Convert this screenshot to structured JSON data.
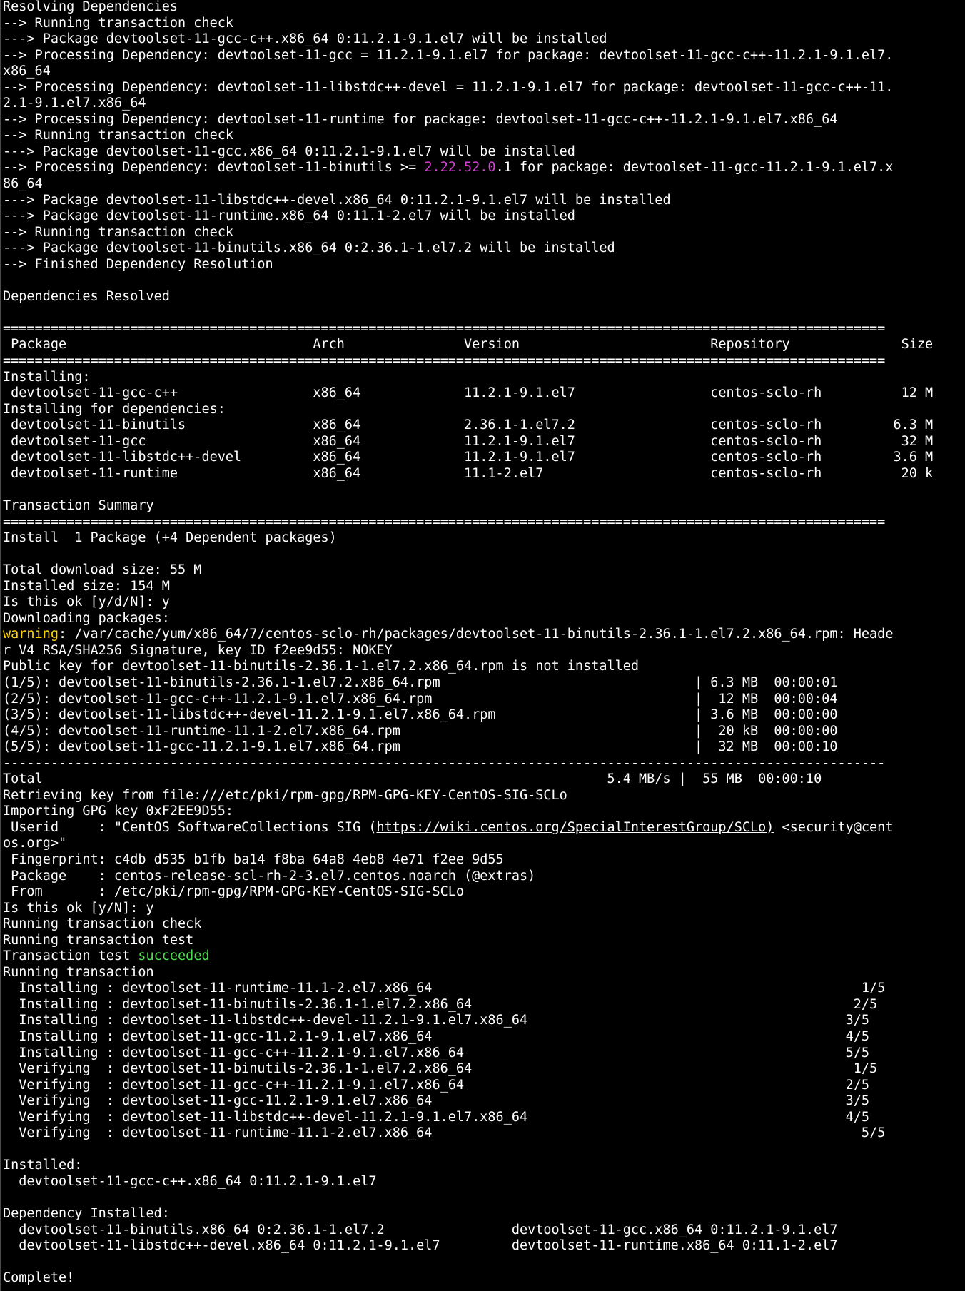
{
  "colors": {
    "background": "#000000",
    "foreground": "#ffffff",
    "warning": "#ffd700",
    "version_highlight": "#d43fd4",
    "success": "#4fdc4f"
  },
  "lines": [
    {
      "name": "log-line",
      "segments": [
        {
          "text": "Resolving Dependencies"
        }
      ]
    },
    {
      "name": "log-line",
      "segments": [
        {
          "text": "--> Running transaction check"
        }
      ]
    },
    {
      "name": "log-line",
      "segments": [
        {
          "text": "---> Package devtoolset-11-gcc-c++.x86_64 0:11.2.1-9.1.el7 will be installed"
        }
      ]
    },
    {
      "name": "log-line",
      "segments": [
        {
          "text": "--> Processing Dependency: devtoolset-11-gcc = 11.2.1-9.1.el7 for package: devtoolset-11-gcc-c++-11.2.1-9.1.el7."
        }
      ]
    },
    {
      "name": "log-line",
      "segments": [
        {
          "text": "x86_64"
        }
      ]
    },
    {
      "name": "log-line",
      "segments": [
        {
          "text": "--> Processing Dependency: devtoolset-11-libstdc++-devel = 11.2.1-9.1.el7 for package: devtoolset-11-gcc-c++-11."
        }
      ]
    },
    {
      "name": "log-line",
      "segments": [
        {
          "text": "2.1-9.1.el7.x86_64"
        }
      ]
    },
    {
      "name": "log-line",
      "segments": [
        {
          "text": "--> Processing Dependency: devtoolset-11-runtime for package: devtoolset-11-gcc-c++-11.2.1-9.1.el7.x86_64"
        }
      ]
    },
    {
      "name": "log-line",
      "segments": [
        {
          "text": "--> Running transaction check"
        }
      ]
    },
    {
      "name": "log-line",
      "segments": [
        {
          "text": "---> Package devtoolset-11-gcc.x86_64 0:11.2.1-9.1.el7 will be installed"
        }
      ]
    },
    {
      "name": "log-line",
      "segments": [
        {
          "text": "--> Processing Dependency: devtoolset-11-binutils >= "
        },
        {
          "text": "2.22.52.0",
          "class": "seg-magenta"
        },
        {
          "text": ".1 for package: devtoolset-11-gcc-11.2.1-9.1.el7.x"
        }
      ]
    },
    {
      "name": "log-line",
      "segments": [
        {
          "text": "86_64"
        }
      ]
    },
    {
      "name": "log-line",
      "segments": [
        {
          "text": "---> Package devtoolset-11-libstdc++-devel.x86_64 0:11.2.1-9.1.el7 will be installed"
        }
      ]
    },
    {
      "name": "log-line",
      "segments": [
        {
          "text": "---> Package devtoolset-11-runtime.x86_64 0:11.1-2.el7 will be installed"
        }
      ]
    },
    {
      "name": "log-line",
      "segments": [
        {
          "text": "--> Running transaction check"
        }
      ]
    },
    {
      "name": "log-line",
      "segments": [
        {
          "text": "---> Package devtoolset-11-binutils.x86_64 0:2.36.1-1.el7.2 will be installed"
        }
      ]
    },
    {
      "name": "log-line",
      "segments": [
        {
          "text": "--> Finished Dependency Resolution"
        }
      ]
    },
    {
      "name": "blank-line",
      "segments": [
        {
          "text": ""
        }
      ]
    },
    {
      "name": "section-heading",
      "segments": [
        {
          "text": "Dependencies Resolved"
        }
      ]
    },
    {
      "name": "blank-line",
      "segments": [
        {
          "text": ""
        }
      ]
    },
    {
      "name": "separator-line",
      "segments": [
        {
          "text": "==============================================================================================================="
        }
      ]
    },
    {
      "name": "table-header",
      "segments": [
        {
          "text": " Package                               Arch               Version                        Repository              Size"
        }
      ]
    },
    {
      "name": "separator-line",
      "segments": [
        {
          "text": "==============================================================================================================="
        }
      ]
    },
    {
      "name": "table-group-heading",
      "segments": [
        {
          "text": "Installing:"
        }
      ]
    },
    {
      "name": "table-row",
      "segments": [
        {
          "text": " devtoolset-11-gcc-c++                 x86_64             11.2.1-9.1.el7                 centos-sclo-rh          12 M"
        }
      ]
    },
    {
      "name": "table-group-heading",
      "segments": [
        {
          "text": "Installing for dependencies:"
        }
      ]
    },
    {
      "name": "table-row",
      "segments": [
        {
          "text": " devtoolset-11-binutils                x86_64             2.36.1-1.el7.2                 centos-sclo-rh         6.3 M"
        }
      ]
    },
    {
      "name": "table-row",
      "segments": [
        {
          "text": " devtoolset-11-gcc                     x86_64             11.2.1-9.1.el7                 centos-sclo-rh          32 M"
        }
      ]
    },
    {
      "name": "table-row",
      "segments": [
        {
          "text": " devtoolset-11-libstdc++-devel         x86_64             11.2.1-9.1.el7                 centos-sclo-rh         3.6 M"
        }
      ]
    },
    {
      "name": "table-row",
      "segments": [
        {
          "text": " devtoolset-11-runtime                 x86_64             11.1-2.el7                     centos-sclo-rh          20 k"
        }
      ]
    },
    {
      "name": "blank-line",
      "segments": [
        {
          "text": ""
        }
      ]
    },
    {
      "name": "section-heading",
      "segments": [
        {
          "text": "Transaction Summary"
        }
      ]
    },
    {
      "name": "separator-line",
      "segments": [
        {
          "text": "==============================================================================================================="
        }
      ]
    },
    {
      "name": "log-line",
      "segments": [
        {
          "text": "Install  1 Package (+4 Dependent packages)"
        }
      ]
    },
    {
      "name": "blank-line",
      "segments": [
        {
          "text": ""
        }
      ]
    },
    {
      "name": "log-line",
      "segments": [
        {
          "text": "Total download size: 55 M"
        }
      ]
    },
    {
      "name": "log-line",
      "segments": [
        {
          "text": "Installed size: 154 M"
        }
      ]
    },
    {
      "name": "prompt-line",
      "segments": [
        {
          "text": "Is this ok [y/d/N]: y"
        }
      ]
    },
    {
      "name": "log-line",
      "segments": [
        {
          "text": "Downloading packages:"
        }
      ]
    },
    {
      "name": "warning-line",
      "segments": [
        {
          "text": "warning",
          "class": "seg-yellow"
        },
        {
          "text": ": /var/cache/yum/x86_64/7/centos-sclo-rh/packages/devtoolset-11-binutils-2.36.1-1.el7.2.x86_64.rpm: Heade"
        }
      ]
    },
    {
      "name": "warning-line",
      "segments": [
        {
          "text": "r V4 RSA/SHA256 Signature, key ID f2ee9d55: NOKEY"
        }
      ]
    },
    {
      "name": "log-line",
      "segments": [
        {
          "text": "Public key for devtoolset-11-binutils-2.36.1-1.el7.2.x86_64.rpm is not installed"
        }
      ]
    },
    {
      "name": "download-line",
      "segments": [
        {
          "text": "(1/5): devtoolset-11-binutils-2.36.1-1.el7.2.x86_64.rpm                                | 6.3 MB  00:00:01"
        }
      ]
    },
    {
      "name": "download-line",
      "segments": [
        {
          "text": "(2/5): devtoolset-11-gcc-c++-11.2.1-9.1.el7.x86_64.rpm                                 |  12 MB  00:00:04"
        }
      ]
    },
    {
      "name": "download-line",
      "segments": [
        {
          "text": "(3/5): devtoolset-11-libstdc++-devel-11.2.1-9.1.el7.x86_64.rpm                         | 3.6 MB  00:00:00"
        }
      ]
    },
    {
      "name": "download-line",
      "segments": [
        {
          "text": "(4/5): devtoolset-11-runtime-11.1-2.el7.x86_64.rpm                                     |  20 kB  00:00:00"
        }
      ]
    },
    {
      "name": "download-line",
      "segments": [
        {
          "text": "(5/5): devtoolset-11-gcc-11.2.1-9.1.el7.x86_64.rpm                                     |  32 MB  00:00:10"
        }
      ]
    },
    {
      "name": "separator-line",
      "segments": [
        {
          "text": "---------------------------------------------------------------------------------------------------------------"
        }
      ]
    },
    {
      "name": "download-total-line",
      "segments": [
        {
          "text": "Total                                                                       5.4 MB/s |  55 MB  00:00:10"
        }
      ]
    },
    {
      "name": "log-line",
      "segments": [
        {
          "text": "Retrieving key from file:///etc/pki/rpm-gpg/RPM-GPG-KEY-CentOS-SIG-SCLo"
        }
      ]
    },
    {
      "name": "log-line",
      "segments": [
        {
          "text": "Importing GPG key 0xF2EE9D55:"
        }
      ]
    },
    {
      "name": "gpg-userid-line",
      "segments": [
        {
          "text": " Userid     : \"CentOS SoftwareCollections SIG ("
        },
        {
          "text": "https://wiki.centos.org/SpecialInterestGroup/SCLo)",
          "class": "seg-link"
        },
        {
          "text": " <security@cent"
        }
      ]
    },
    {
      "name": "gpg-userid-line",
      "segments": [
        {
          "text": "os.org>\""
        }
      ]
    },
    {
      "name": "gpg-line",
      "segments": [
        {
          "text": " Fingerprint: c4db d535 b1fb ba14 f8ba 64a8 4eb8 4e71 f2ee 9d55"
        }
      ]
    },
    {
      "name": "gpg-line",
      "segments": [
        {
          "text": " Package    : centos-release-scl-rh-2-3.el7.centos.noarch (@extras)"
        }
      ]
    },
    {
      "name": "gpg-line",
      "segments": [
        {
          "text": " From       : /etc/pki/rpm-gpg/RPM-GPG-KEY-CentOS-SIG-SCLo"
        }
      ]
    },
    {
      "name": "prompt-line",
      "segments": [
        {
          "text": "Is this ok [y/N]: y"
        }
      ]
    },
    {
      "name": "log-line",
      "segments": [
        {
          "text": "Running transaction check"
        }
      ]
    },
    {
      "name": "log-line",
      "segments": [
        {
          "text": "Running transaction test"
        }
      ]
    },
    {
      "name": "log-line",
      "segments": [
        {
          "text": "Transaction test "
        },
        {
          "text": "succeeded",
          "class": "seg-green"
        }
      ]
    },
    {
      "name": "log-line",
      "segments": [
        {
          "text": "Running transaction"
        }
      ]
    },
    {
      "name": "progress-line",
      "segments": [
        {
          "text": "  Installing : devtoolset-11-runtime-11.1-2.el7.x86_64                                                      1/5"
        }
      ]
    },
    {
      "name": "progress-line",
      "segments": [
        {
          "text": "  Installing : devtoolset-11-binutils-2.36.1-1.el7.2.x86_64                                                2/5"
        }
      ]
    },
    {
      "name": "progress-line",
      "segments": [
        {
          "text": "  Installing : devtoolset-11-libstdc++-devel-11.2.1-9.1.el7.x86_64                                        3/5"
        }
      ]
    },
    {
      "name": "progress-line",
      "segments": [
        {
          "text": "  Installing : devtoolset-11-gcc-11.2.1-9.1.el7.x86_64                                                    4/5"
        }
      ]
    },
    {
      "name": "progress-line",
      "segments": [
        {
          "text": "  Installing : devtoolset-11-gcc-c++-11.2.1-9.1.el7.x86_64                                                5/5"
        }
      ]
    },
    {
      "name": "progress-line",
      "segments": [
        {
          "text": "  Verifying  : devtoolset-11-binutils-2.36.1-1.el7.2.x86_64                                                1/5"
        }
      ]
    },
    {
      "name": "progress-line",
      "segments": [
        {
          "text": "  Verifying  : devtoolset-11-gcc-c++-11.2.1-9.1.el7.x86_64                                                2/5"
        }
      ]
    },
    {
      "name": "progress-line",
      "segments": [
        {
          "text": "  Verifying  : devtoolset-11-gcc-11.2.1-9.1.el7.x86_64                                                    3/5"
        }
      ]
    },
    {
      "name": "progress-line",
      "segments": [
        {
          "text": "  Verifying  : devtoolset-11-libstdc++-devel-11.2.1-9.1.el7.x86_64                                        4/5"
        }
      ]
    },
    {
      "name": "progress-line",
      "segments": [
        {
          "text": "  Verifying  : devtoolset-11-runtime-11.1-2.el7.x86_64                                                      5/5"
        }
      ]
    },
    {
      "name": "blank-line",
      "segments": [
        {
          "text": ""
        }
      ]
    },
    {
      "name": "section-heading",
      "segments": [
        {
          "text": "Installed:"
        }
      ]
    },
    {
      "name": "installed-line",
      "segments": [
        {
          "text": "  devtoolset-11-gcc-c++.x86_64 0:11.2.1-9.1.el7"
        }
      ]
    },
    {
      "name": "blank-line",
      "segments": [
        {
          "text": ""
        }
      ]
    },
    {
      "name": "section-heading",
      "segments": [
        {
          "text": "Dependency Installed:"
        }
      ]
    },
    {
      "name": "installed-line",
      "segments": [
        {
          "text": "  devtoolset-11-binutils.x86_64 0:2.36.1-1.el7.2                devtoolset-11-gcc.x86_64 0:11.2.1-9.1.el7"
        }
      ]
    },
    {
      "name": "installed-line",
      "segments": [
        {
          "text": "  devtoolset-11-libstdc++-devel.x86_64 0:11.2.1-9.1.el7         devtoolset-11-runtime.x86_64 0:11.1-2.el7"
        }
      ]
    },
    {
      "name": "blank-line",
      "segments": [
        {
          "text": ""
        }
      ]
    },
    {
      "name": "completion-line",
      "segments": [
        {
          "text": "Complete!"
        }
      ]
    }
  ]
}
